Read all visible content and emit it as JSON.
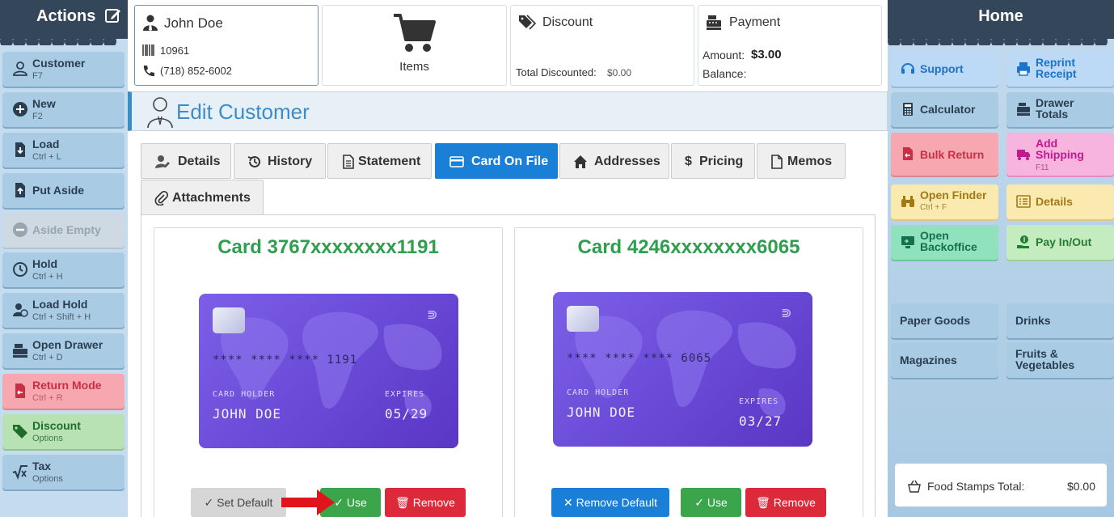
{
  "left": {
    "title": "Actions",
    "buttons": [
      {
        "label": "Customer",
        "shortcut": "F7"
      },
      {
        "label": "New",
        "shortcut": "F2"
      },
      {
        "label": "Load",
        "shortcut": "Ctrl + L"
      },
      {
        "label": "Put Aside",
        "shortcut": ""
      },
      {
        "label": "Aside Empty",
        "shortcut": ""
      },
      {
        "label": "Hold",
        "shortcut": "Ctrl + H"
      },
      {
        "label": "Load Hold",
        "shortcut": "Ctrl + Shift + H"
      },
      {
        "label": "Open Drawer",
        "shortcut": "Ctrl + D"
      },
      {
        "label": "Return Mode",
        "shortcut": "Ctrl + R"
      },
      {
        "label": "Discount",
        "shortcut": "Options"
      },
      {
        "label": "Tax",
        "shortcut": "Options"
      }
    ]
  },
  "header": {
    "customer": {
      "name": "John Doe",
      "id": "10961",
      "phone": "(718) 852-6002"
    },
    "items": {
      "label": "Items"
    },
    "discount": {
      "title": "Discount",
      "total_label": "Total Discounted:",
      "total_value": "$0.00"
    },
    "payment": {
      "title": "Payment",
      "amount_label": "Amount:",
      "amount_value": "$3.00",
      "balance_label": "Balance:"
    }
  },
  "page": {
    "title": "Edit Customer"
  },
  "tabs": [
    "Details",
    "History",
    "Statement",
    "Card On File",
    "Addresses",
    "Pricing",
    "Memos",
    "Attachments"
  ],
  "cards": [
    {
      "title": "Card 3767xxxxxxxx1191",
      "masked": "**** **** **** 1191",
      "holder_label": "CARD HOLDER",
      "holder": "JOHN DOE",
      "expires_label": "EXPIRES",
      "expires": "05/29",
      "buttons": [
        "Set Default",
        "Use",
        "Remove"
      ]
    },
    {
      "title": "Card 4246xxxxxxxx6065",
      "masked": "**** **** **** 6065",
      "holder_label": "CARD HOLDER",
      "holder": "JOHN DOE",
      "expires_label": "EXPIRES",
      "expires": "03/27",
      "buttons": [
        "Remove Default",
        "Use",
        "Remove"
      ]
    }
  ],
  "right": {
    "title": "Home",
    "buttons": [
      {
        "label": "Support"
      },
      {
        "label": "Reprint Receipt"
      },
      {
        "label": "Calculator"
      },
      {
        "label": "Drawer Totals"
      },
      {
        "label": "Bulk Return"
      },
      {
        "label": "Add Shipping",
        "shortcut": "F11"
      },
      {
        "label": "Open Finder",
        "shortcut": "Ctrl + F"
      },
      {
        "label": "Details"
      },
      {
        "label": "Open Backoffice"
      },
      {
        "label": "Pay In/Out"
      }
    ],
    "categories": [
      "Paper Goods",
      "Drinks",
      "Magazines",
      "Fruits & Vegetables"
    ],
    "food_stamps": {
      "label": "Food Stamps Total:",
      "value": "$0.00"
    }
  },
  "colors": {
    "accent": "#1a7fd6",
    "header_dark": "#33465a",
    "success": "#3aa54a",
    "danger": "#dc2a3a",
    "card_title": "#2e9f4e"
  }
}
